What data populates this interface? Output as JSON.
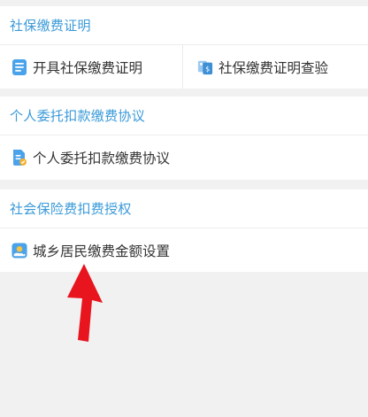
{
  "sections": [
    {
      "title": "社保缴费证明",
      "items": [
        {
          "label": "开具社保缴费证明",
          "icon": "document-list-icon"
        },
        {
          "label": "社保缴费证明查验",
          "icon": "certificate-check-icon"
        }
      ]
    },
    {
      "title": "个人委托扣款缴费协议",
      "items": [
        {
          "label": "个人委托扣款缴费协议",
          "icon": "agreement-document-icon"
        }
      ]
    },
    {
      "title": "社会保险费扣费授权",
      "items": [
        {
          "label": "城乡居民缴费金额设置",
          "icon": "hand-coin-icon"
        }
      ]
    }
  ],
  "colors": {
    "section_title": "#3a9ad9",
    "item_text": "#333333",
    "background": "#f1f1f1",
    "annotation_arrow": "#e8141e"
  }
}
